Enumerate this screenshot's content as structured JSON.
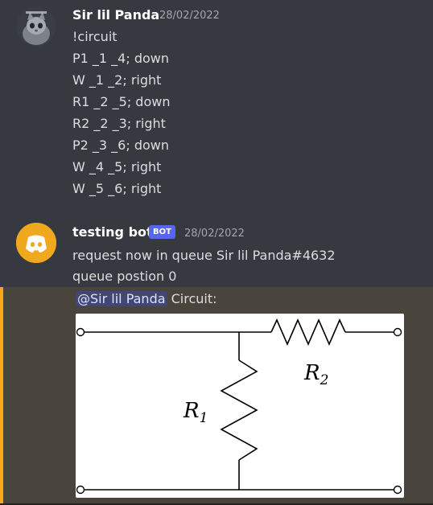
{
  "message1": {
    "author": "Sir lil Panda",
    "timestamp": "28/02/2022",
    "lines": [
      "!circuit",
      "P1 _1 _4; down",
      "W  _1 _2; right",
      "R1 _2 _5; down",
      "R2  _2 _3; right",
      "P2 _3 _6; down",
      "W  _4 _5; right",
      "W  _5 _6; right"
    ]
  },
  "message2": {
    "author": "testing bot",
    "bot_tag": "BOT",
    "timestamp": "28/02/2022",
    "lines": [
      "request now in queue Sir lil Panda#4632",
      "queue postion 0"
    ],
    "mention": "@Sir lil Panda",
    "mention_suffix": " Circuit:"
  },
  "circuit": {
    "r1_label": "R",
    "r1_sub": "1",
    "r2_label": "R",
    "r2_sub": "2"
  },
  "colors": {
    "background": "#36393f",
    "mention_highlight": "#49443c",
    "mention_bar": "#faa61a",
    "bot_tag": "#5865f2",
    "bot_avatar": "#f0a81e"
  }
}
